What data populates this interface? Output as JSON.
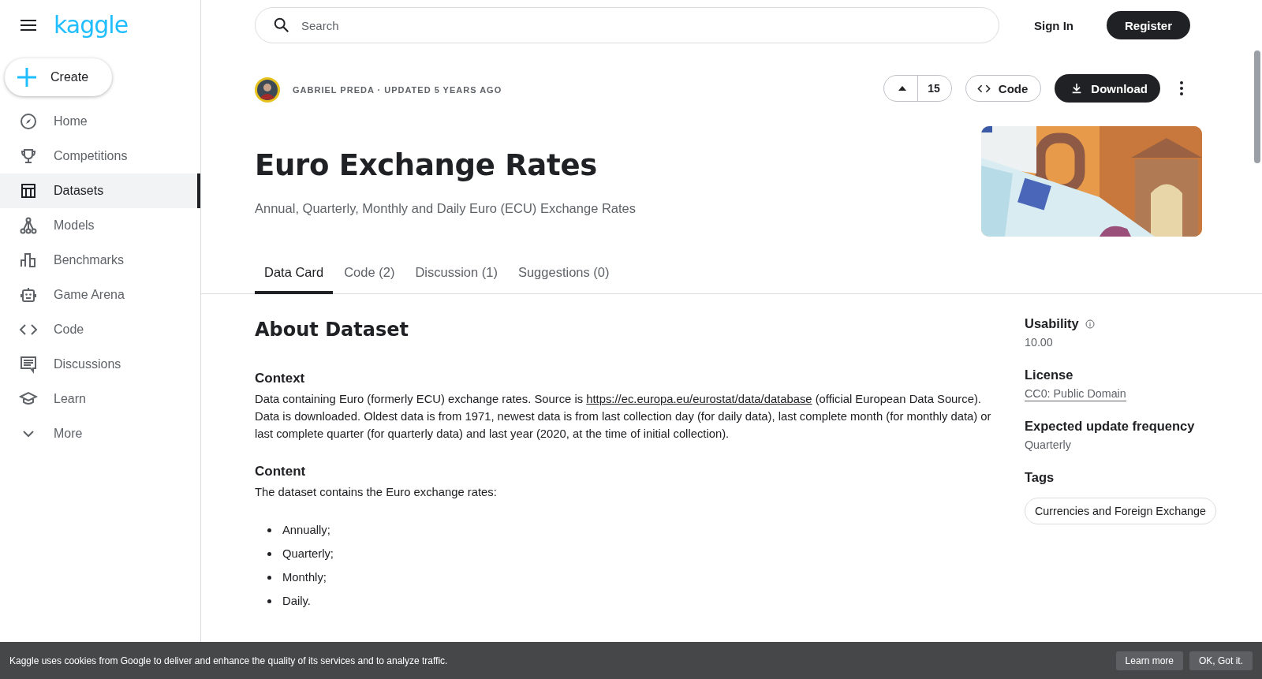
{
  "sidebar": {
    "logo": "kaggle",
    "create": "Create",
    "items": [
      {
        "label": "Home",
        "selected": false
      },
      {
        "label": "Competitions",
        "selected": false
      },
      {
        "label": "Datasets",
        "selected": true
      },
      {
        "label": "Models",
        "selected": false
      },
      {
        "label": "Benchmarks",
        "selected": false
      },
      {
        "label": "Game Arena",
        "selected": false
      },
      {
        "label": "Code",
        "selected": false
      },
      {
        "label": "Discussions",
        "selected": false
      },
      {
        "label": "Learn",
        "selected": false
      },
      {
        "label": "More",
        "selected": false
      }
    ]
  },
  "header": {
    "search": {
      "placeholder": "Search"
    },
    "sign_in": "Sign In",
    "register": "Register"
  },
  "dataset": {
    "byline": "GABRIEL PREDA · UPDATED 5 YEARS AGO",
    "votes": "15",
    "code_button": "Code",
    "download_button": "Download",
    "title": "Euro Exchange Rates",
    "subtitle": "Annual, Quarterly, Monthly and Daily Euro (ECU) Exchange Rates"
  },
  "tabs": [
    {
      "label": "Data Card",
      "selected": true
    },
    {
      "label": "Code (2)",
      "selected": false
    },
    {
      "label": "Discussion (1)",
      "selected": false
    },
    {
      "label": "Suggestions (0)",
      "selected": false
    }
  ],
  "about": {
    "heading": "About Dataset",
    "sections": [
      {
        "heading": "Context",
        "text_before": "Data containing Euro (formerly ECU) exchange rates. Source is ",
        "link": "https://ec.europa.eu/eurostat/data/database",
        "text_after": " (official European Data Source). Data is downloaded. Oldest data is from 1971, newest data is from last collection day (for daily data), last complete month (for monthly data) or last complete quarter (for quarterly data) and last year (2020, at the time of initial collection)."
      },
      {
        "heading": "Content",
        "text_before": "The dataset contains the Euro exchange rates:",
        "list": [
          "Annually;",
          "Quarterly;",
          "Monthly;",
          "Daily."
        ]
      }
    ]
  },
  "metadata": {
    "usability": {
      "label": "Usability",
      "value": "10.00"
    },
    "license": {
      "label": "License",
      "value": "CC0: Public Domain"
    },
    "frequency": {
      "label": "Expected update frequency",
      "value": "Quarterly"
    },
    "tags": {
      "label": "Tags",
      "items": [
        "Currencies and Foreign Exchange"
      ]
    }
  },
  "cookie_bar": {
    "text": "Kaggle uses cookies from Google to deliver and enhance the quality of its services and to analyze traffic.",
    "learn_more": "Learn more",
    "ok": "OK, Got it."
  }
}
